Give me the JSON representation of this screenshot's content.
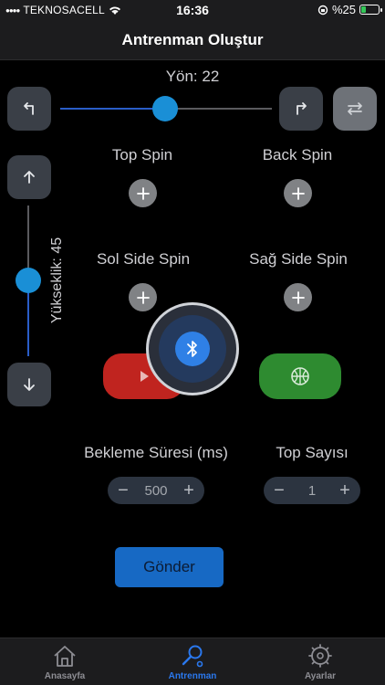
{
  "status": {
    "carrier": "TEKNOSACELL",
    "time": "16:36",
    "battery_text": "%25",
    "battery_level": 0.25
  },
  "nav": {
    "title": "Antrenman Oluştur"
  },
  "direction": {
    "label": "Yön: 22",
    "value": 22
  },
  "height": {
    "label": "Yükseklik: 45",
    "value": 45
  },
  "spins": {
    "top": "Top Spin",
    "back": "Back Spin",
    "left_side": "Sol Side Spin",
    "right_side": "Sağ Side Spin"
  },
  "wait": {
    "label": "Bekleme Süresi (ms)",
    "value": "500",
    "minus": "−",
    "plus": "+"
  },
  "ball_count": {
    "label": "Top Sayısı",
    "value": "1",
    "minus": "−",
    "plus": "+"
  },
  "send_label": "Gönder",
  "tabs": [
    {
      "label": "Anasayfa",
      "icon": "house-icon"
    },
    {
      "label": "Antrenman",
      "icon": "training-icon",
      "active": true
    },
    {
      "label": "Ayarlar",
      "icon": "settings-icon"
    }
  ],
  "colors": {
    "accent": "#2a78ee",
    "play_button": "#c0241f",
    "ball_button": "#2e8b30",
    "send_button": "#1769c4"
  },
  "icons": {
    "bluetooth": "bluetooth-icon",
    "play": "play-icon",
    "ball": "basketball-icon",
    "swap": "swap-icon"
  }
}
